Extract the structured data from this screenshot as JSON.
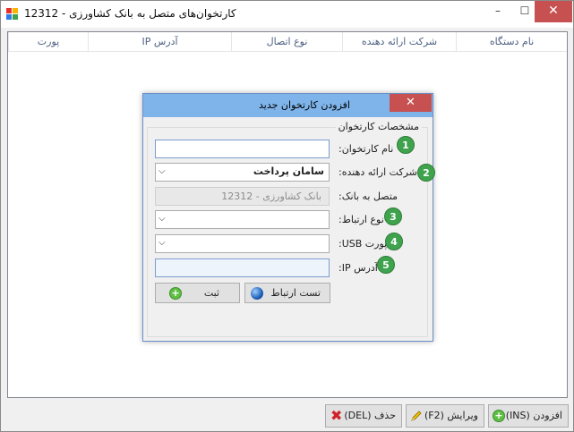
{
  "window": {
    "title": "کارتخوان‌های متصل به بانک کشاورزی - 12312",
    "minimize": "–",
    "maximize": "☐",
    "close": "✕"
  },
  "listview": {
    "columns": [
      "نام دستگاه",
      "شرکت ارائه دهنده",
      "نوع اتصال",
      "آدرس IP",
      "پورت"
    ]
  },
  "dialog": {
    "title": "افزودن کارتخوان جدید",
    "close": "✕",
    "group_title": "مشخصات کارتخوان",
    "fields": {
      "name": {
        "label": "نام کارتخوان:",
        "value": "",
        "badge": "1"
      },
      "provider": {
        "label": "شرکت ارائه دهنده:",
        "value": "سامان پرداخت",
        "badge": "2"
      },
      "bank": {
        "label": "متصل به بانک:",
        "value": "بانک کشاورزی - 12312"
      },
      "connection": {
        "label": "نوع ارتباط:",
        "value": "",
        "badge": "3"
      },
      "usb": {
        "label": "پورت USB:",
        "value": "",
        "badge": "4"
      },
      "ip": {
        "label": "آدرس IP:",
        "value": "",
        "badge": "5"
      }
    },
    "test_button": "تست ارتباط",
    "save_button": "ثبت"
  },
  "footer": {
    "add_button": "افزودن (INS)",
    "edit_button": "ویرایش (F2)",
    "delete_button": "حذف (DEL)"
  },
  "colors": {
    "badge": "#3fa34d",
    "dialog_titlebar": "#7eb4ea",
    "close_button": "#c75050"
  }
}
